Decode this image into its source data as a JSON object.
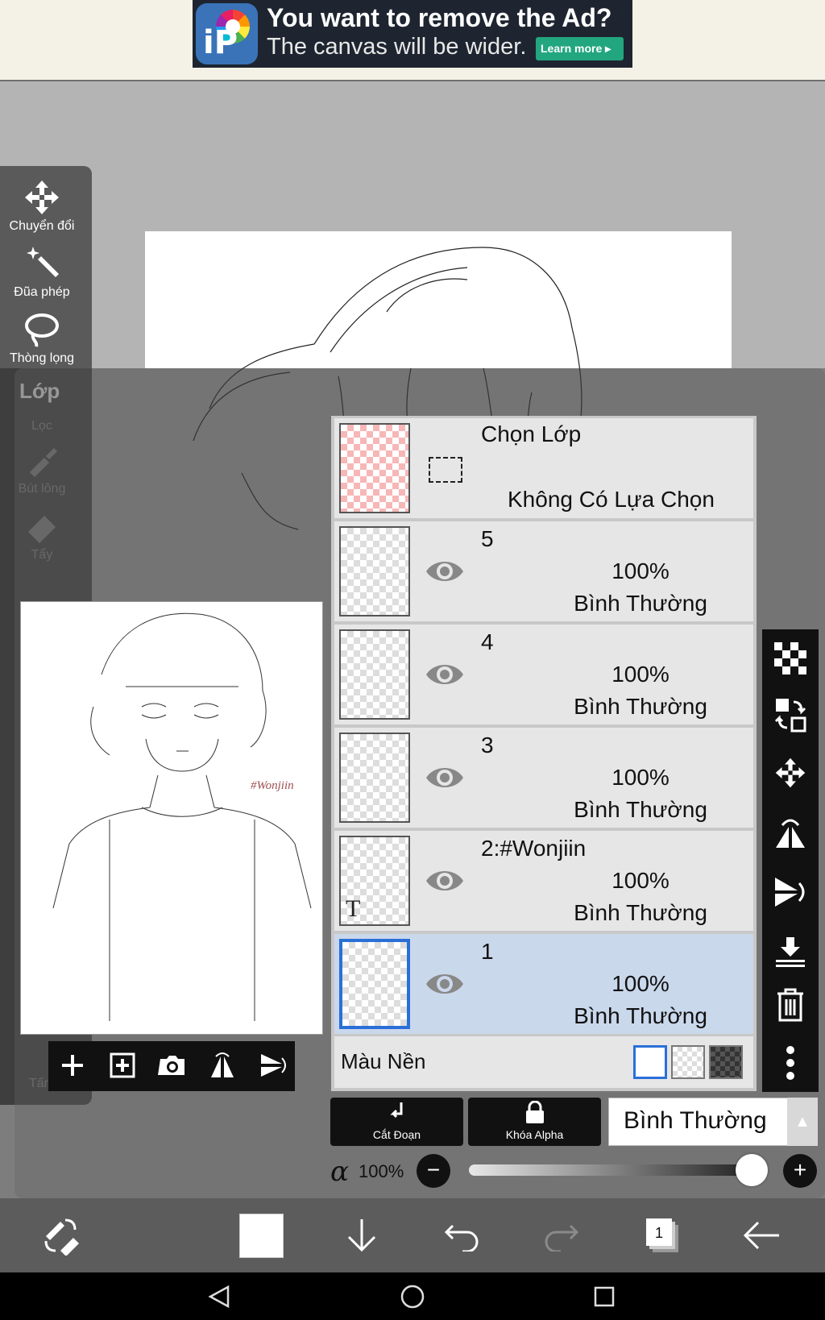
{
  "ad": {
    "logo_text": "iP",
    "title": "You want to remove the Ad?",
    "subtitle": "The canvas will be wider.",
    "learn_more": "Learn more ▸"
  },
  "tools": [
    {
      "label": "Chuyển đổi",
      "icon": "move-arrows-icon"
    },
    {
      "label": "Đũa phép",
      "icon": "magic-wand-icon"
    },
    {
      "label": "Thòng lọng",
      "icon": "lasso-icon"
    },
    {
      "label": "Lớp",
      "icon": "layer-icon"
    },
    {
      "label": "Lọc",
      "icon": "filter-icon"
    },
    {
      "label": "Bút lông",
      "icon": "brush-icon"
    },
    {
      "label": "Tẩy",
      "icon": "eraser-icon"
    },
    {
      "label": "Tấm",
      "icon": "canvas-icon"
    }
  ],
  "preview": {
    "watermark": "#Wonjiin"
  },
  "selection_layer": {
    "title": "Chọn Lớp",
    "status": "Không Có Lựa Chọn"
  },
  "layers": [
    {
      "name": "5",
      "opacity": "100%",
      "blend": "Bình Thường",
      "selected": false,
      "text_layer": false
    },
    {
      "name": "4",
      "opacity": "100%",
      "blend": "Bình Thường",
      "selected": false,
      "text_layer": false
    },
    {
      "name": "3",
      "opacity": "100%",
      "blend": "Bình Thường",
      "selected": false,
      "text_layer": false
    },
    {
      "name": "2:#Wonjiin",
      "opacity": "100%",
      "blend": "Bình Thường",
      "selected": false,
      "text_layer": true
    },
    {
      "name": "1",
      "opacity": "100%",
      "blend": "Bình Thường",
      "selected": true,
      "text_layer": false
    }
  ],
  "text_layer_marker": "T",
  "background": {
    "label": "Màu Nền",
    "selected": "white"
  },
  "controls": {
    "clipping": "Cắt Đoạn",
    "alpha_lock": "Khóa Alpha",
    "blend_mode": "Bình Thường",
    "blend_arrow": "▲",
    "alpha_symbol": "α",
    "alpha_value": "100%",
    "minus": "−",
    "plus": "+",
    "opacity_fraction": 1.0
  },
  "appbar": {
    "layer_count": "1"
  },
  "colors": {
    "selected_row": "#cad8ec",
    "accent_blue": "#2a6fd8",
    "ad_button": "#22a67f",
    "toolbar": "#5a5a5a"
  }
}
